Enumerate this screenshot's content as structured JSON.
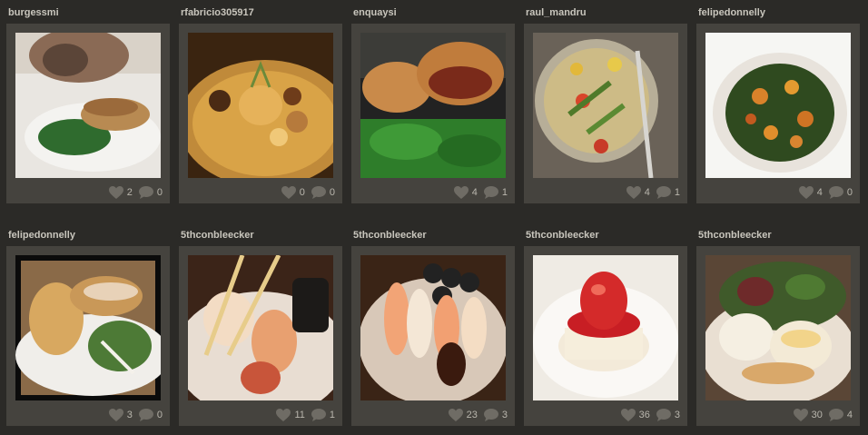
{
  "photos": [
    {
      "user": "burgessmi",
      "likes": "2",
      "comments": "0"
    },
    {
      "user": "rfabricio305917",
      "likes": "0",
      "comments": "0"
    },
    {
      "user": "enquaysi",
      "likes": "4",
      "comments": "1"
    },
    {
      "user": "raul_mandru",
      "likes": "4",
      "comments": "1"
    },
    {
      "user": "felipedonnelly",
      "likes": "4",
      "comments": "0"
    },
    {
      "user": "felipedonnelly",
      "likes": "3",
      "comments": "0"
    },
    {
      "user": "5thconbleecker",
      "likes": "11",
      "comments": "1"
    },
    {
      "user": "5thconbleecker",
      "likes": "23",
      "comments": "3"
    },
    {
      "user": "5thconbleecker",
      "likes": "36",
      "comments": "3"
    },
    {
      "user": "5thconbleecker",
      "likes": "30",
      "comments": "4"
    }
  ],
  "colors": {
    "page_bg": "#2b2a27",
    "card_bg": "#45433e",
    "username": "#c9c6bd",
    "stat_text": "#b9b6ad",
    "icon": "#6f6c65"
  },
  "icons": {
    "like": "heart-icon",
    "comment": "speech-bubble-icon"
  }
}
